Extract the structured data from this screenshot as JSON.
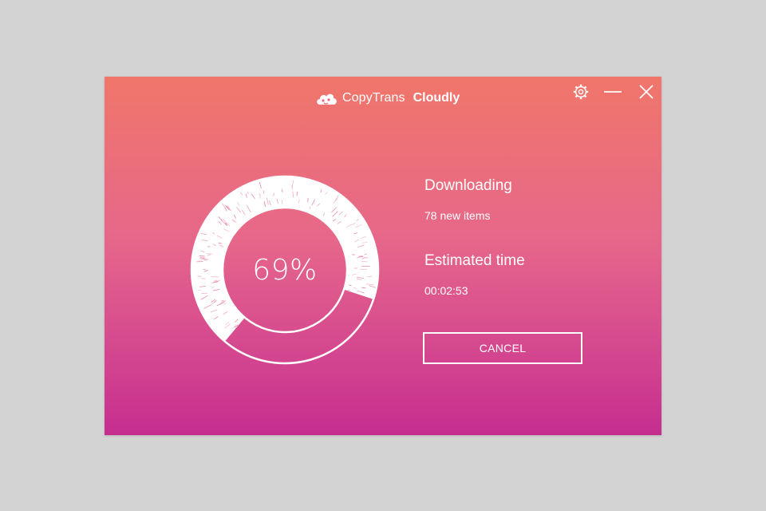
{
  "app": {
    "brand_light": "CopyTrans",
    "brand_bold": "Cloudly"
  },
  "window_controls": {
    "settings_icon": "gear-icon",
    "minimize_icon": "minimize-icon",
    "close_icon": "close-icon"
  },
  "progress": {
    "percent_label": "69%",
    "fraction": 0.69
  },
  "status": {
    "title": "Downloading",
    "subtitle": "78 new items"
  },
  "eta": {
    "title": "Estimated time",
    "value": "00:02:53"
  },
  "actions": {
    "cancel_label": "CANCEL"
  },
  "colors": {
    "gradient_top": "#f0766a",
    "gradient_bottom": "#c52e8f",
    "foreground": "#ffffff",
    "background": "#d3d3d3"
  }
}
